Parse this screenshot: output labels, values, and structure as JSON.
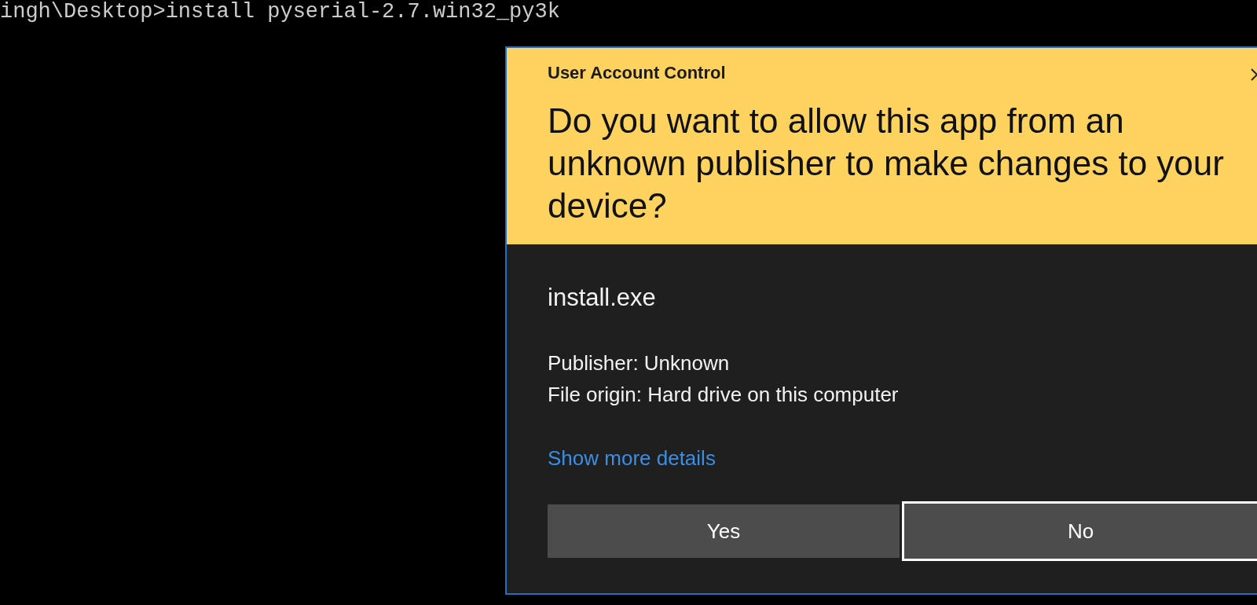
{
  "terminal": {
    "lines": [
      "ingh\\Desktop>install pyserial-2.7.win32_py3k"
    ]
  },
  "dialog": {
    "title": "User Account Control",
    "question": "Do you want to allow this app from an unknown publisher to make changes to your device?",
    "program": "install.exe",
    "details": [
      "Publisher: Unknown",
      "File origin: Hard drive on this computer"
    ],
    "link": "Show more details",
    "buttons": [
      {
        "label": "Yes",
        "focused": false
      },
      {
        "label": "No",
        "focused": true
      }
    ]
  }
}
